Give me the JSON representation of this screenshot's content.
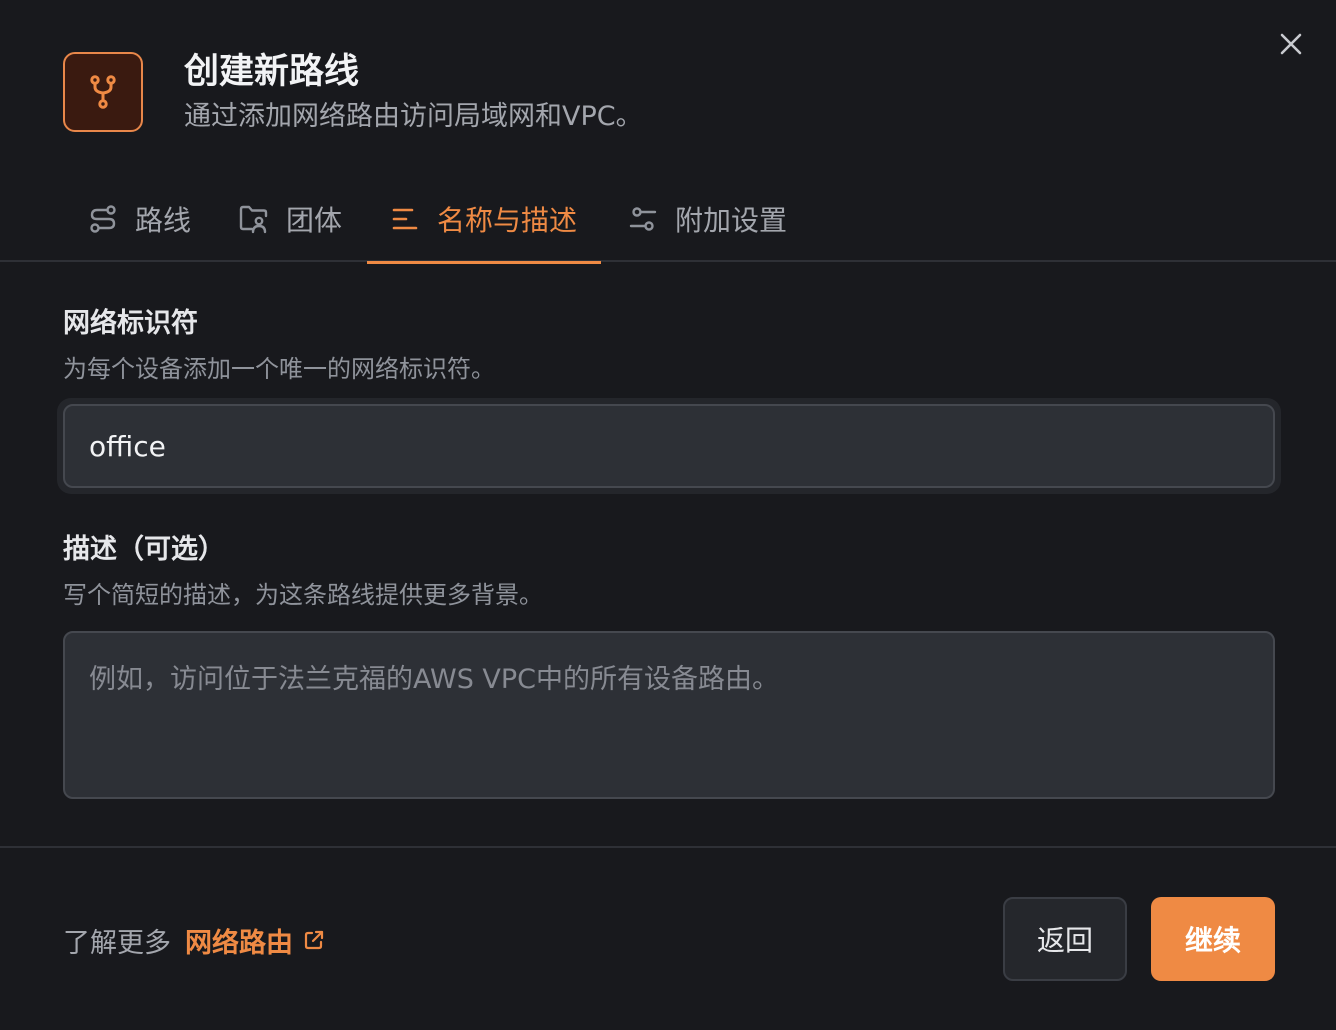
{
  "header": {
    "title": "创建新路线",
    "subtitle": "通过添加网络路由访问局域网和VPC。",
    "icon": "route-fork-icon",
    "accent_color": "#ef8a44"
  },
  "tabs": [
    {
      "label": "路线",
      "icon": "route-icon",
      "active": false
    },
    {
      "label": "团体",
      "icon": "folder-group-icon",
      "active": false
    },
    {
      "label": "名称与描述",
      "icon": "text-lines-icon",
      "active": true
    },
    {
      "label": "附加设置",
      "icon": "settings-sliders-icon",
      "active": false
    }
  ],
  "form": {
    "identifier": {
      "label": "网络标识符",
      "help": "为每个设备添加一个唯一的网络标识符。",
      "value": "office"
    },
    "description": {
      "label": "描述（可选）",
      "help": "写个简短的描述，为这条路线提供更多背景。",
      "placeholder": "例如，访问位于法兰克福的AWS VPC中的所有设备路由。",
      "value": ""
    }
  },
  "footer": {
    "learn_prefix": "了解更多",
    "learn_link": "网络路由",
    "back_label": "返回",
    "continue_label": "继续"
  }
}
